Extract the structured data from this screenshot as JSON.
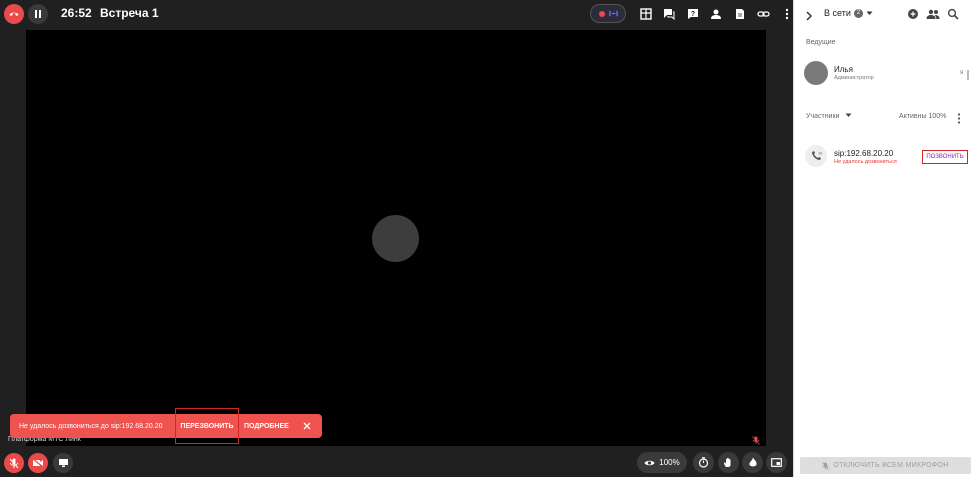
{
  "topbar": {
    "timer": "26:52",
    "meeting_title": "Встреча 1"
  },
  "video": {
    "platform_label": "Платформа МТС Линк"
  },
  "toast": {
    "message": "Не удалось дозвониться до sip:192.68.20.20",
    "retry_label": "ПЕРЕЗВОНИТЬ",
    "more_label": "ПОДРОБНЕЕ"
  },
  "bottombar": {
    "zoom": "100%"
  },
  "sidebar": {
    "online_label": "В сети",
    "online_count": "2",
    "hosts_section": "Ведущие",
    "host": {
      "name": "Илья",
      "role": "Администратор",
      "me_label": "я"
    },
    "participants_label": "Участники",
    "active_label": "Активны 100%",
    "sip": {
      "name": "sip:192.68.20.20",
      "status": "Не удалось дозвониться",
      "call_label": "ПОЗВОНИТЬ"
    },
    "mute_all_label": "ОТКЛЮЧИТЬ ВСЕМ МИКРОФОН"
  },
  "colors": {
    "danger": "#e94b4b",
    "toast": "#ef5350",
    "call_text": "#8e24aa"
  }
}
